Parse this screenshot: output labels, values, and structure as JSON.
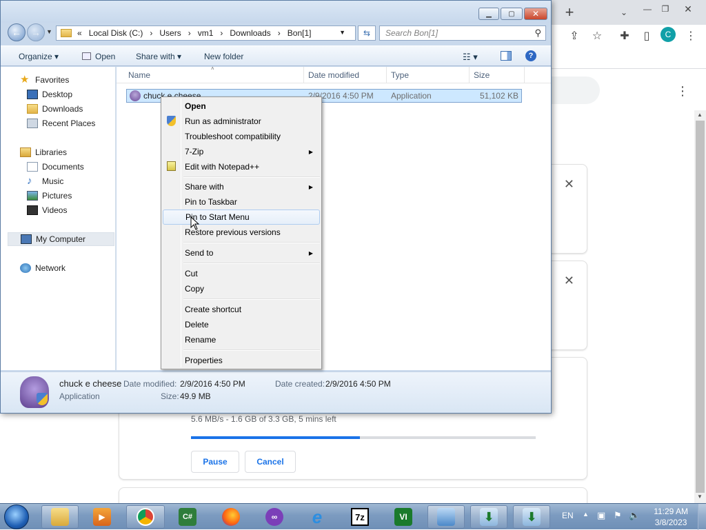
{
  "chrome": {
    "new_tab_icon": "plus-icon",
    "menu_more": "⋮",
    "profile_initial": "C",
    "download": {
      "progress_text": "5.6 MB/s - 1.6 GB of 3.3 GB, 5 mins left",
      "progress_fraction": 0.49,
      "pause_label": "Pause",
      "cancel_label": "Cancel",
      "accent_color": "#1a73e8"
    }
  },
  "explorer": {
    "breadcrumb": [
      "«",
      "Local Disk (C:)",
      "›",
      "Users",
      "›",
      "vm1",
      "›",
      "Downloads",
      "›",
      "Bon[1]"
    ],
    "search_placeholder": "Search Bon[1]",
    "toolbar": {
      "organize": "Organize",
      "open": "Open",
      "share_with": "Share with",
      "new_folder": "New folder"
    },
    "nav": {
      "favorites": "Favorites",
      "desktop": "Desktop",
      "downloads": "Downloads",
      "recent_places": "Recent Places",
      "libraries": "Libraries",
      "documents": "Documents",
      "music": "Music",
      "pictures": "Pictures",
      "videos": "Videos",
      "my_computer": "My Computer",
      "network": "Network"
    },
    "columns": {
      "name": "Name",
      "date_modified": "Date modified",
      "type": "Type",
      "size": "Size"
    },
    "file": {
      "name": "chuck e cheese",
      "date_modified": "2/9/2016 4:50 PM",
      "type": "Application",
      "size": "51,102 KB"
    },
    "details": {
      "name": "chuck e cheese",
      "type": "Application",
      "date_modified_label": "Date modified:",
      "date_modified": "2/9/2016 4:50 PM",
      "date_created_label": "Date created:",
      "date_created": "2/9/2016 4:50 PM",
      "size_label": "Size:",
      "size": "49.9 MB"
    }
  },
  "context_menu": {
    "open": "Open",
    "run_as_admin": "Run as administrator",
    "troubleshoot": "Troubleshoot compatibility",
    "seven_zip": "7-Zip",
    "edit_notepad": "Edit with Notepad++",
    "share_with": "Share with",
    "pin_taskbar": "Pin to Taskbar",
    "pin_start": "Pin to Start Menu",
    "restore_versions": "Restore previous versions",
    "send_to": "Send to",
    "cut": "Cut",
    "copy": "Copy",
    "create_shortcut": "Create shortcut",
    "delete": "Delete",
    "rename": "Rename",
    "properties": "Properties"
  },
  "taskbar": {
    "language": "EN",
    "time": "11:29 AM",
    "date": "3/8/2023",
    "apps": [
      "start-orb",
      "explorer",
      "media-player",
      "chrome",
      "visual-csharp",
      "firefox",
      "tor-mask",
      "internet-explorer",
      "7zip",
      "vim",
      "control-panel",
      "download-app-1",
      "download-app-2"
    ]
  }
}
